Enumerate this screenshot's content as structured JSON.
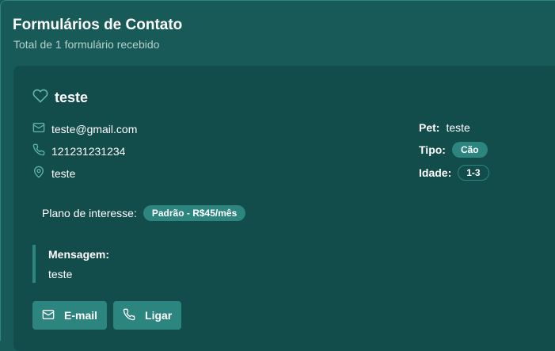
{
  "header": {
    "title": "Formulários de Contato",
    "subtitle": "Total de 1 formulário recebido"
  },
  "submission": {
    "name": "teste",
    "email": "teste@gmail.com",
    "phone": "121231231234",
    "location": "teste",
    "pet": {
      "label": "Pet:",
      "value": "teste"
    },
    "type": {
      "label": "Tipo:",
      "value": "Cão"
    },
    "age": {
      "label": "Idade:",
      "value": "1-3"
    },
    "plan": {
      "label": "Plano de interesse:",
      "value": "Padrão - R$45/mês"
    },
    "message": {
      "label": "Mensagem:",
      "text": "teste"
    },
    "actions": {
      "email_label": "E-mail",
      "call_label": "Ligar"
    }
  },
  "colors": {
    "background": "#175a58",
    "card": "#124c4b",
    "accent": "#2d8580",
    "icon": "#5fb3a9"
  },
  "icons": [
    "heart-icon",
    "mail-icon",
    "phone-icon",
    "map-pin-icon"
  ]
}
